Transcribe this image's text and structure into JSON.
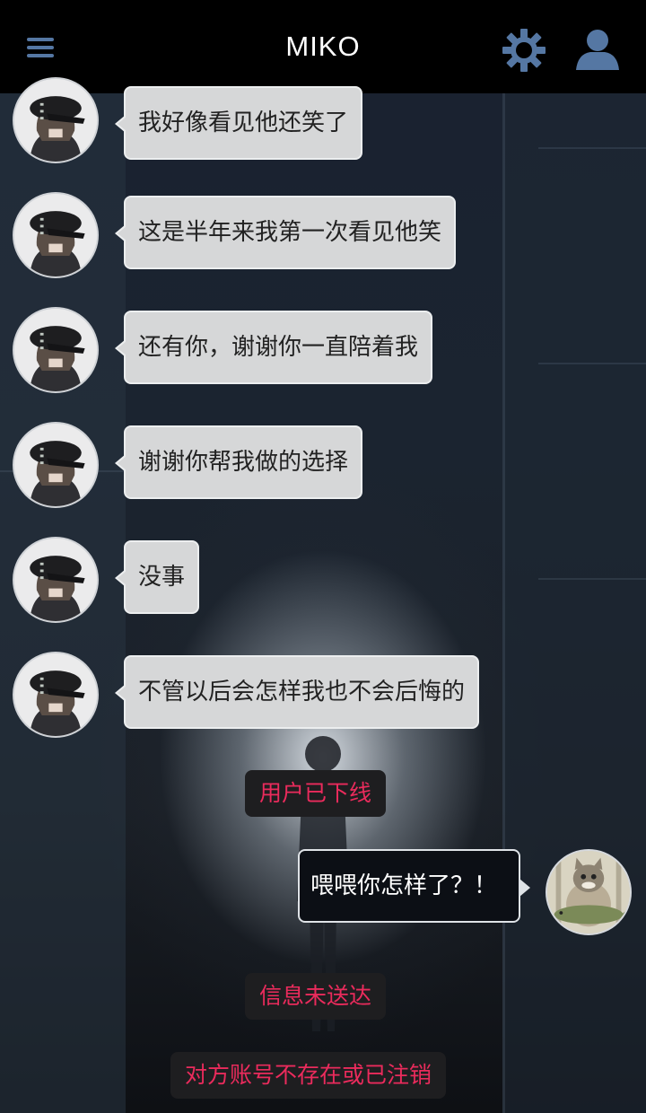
{
  "header": {
    "title": "MIKO",
    "menu_icon": "hamburger-menu-icon",
    "settings_icon": "gear-icon",
    "profile_icon": "user-icon"
  },
  "colors": {
    "header_bg": "#000000",
    "icon_blue": "#5577a3",
    "bubble_in": "#d6d7d8",
    "bubble_out": "#0c0f15",
    "system_text": "#ea2b5c"
  },
  "messages": [
    {
      "from": "miko",
      "text": "我好像看见他还笑了"
    },
    {
      "from": "miko",
      "text": "这是半年来我第一次看见他笑"
    },
    {
      "from": "miko",
      "text": "还有你，谢谢你一直陪着我"
    },
    {
      "from": "miko",
      "text": "谢谢你帮我做的选择"
    },
    {
      "from": "miko",
      "text": "没事"
    },
    {
      "from": "miko",
      "text": "不管以后会怎样我也不会后悔的"
    }
  ],
  "system_offline": "用户已下线",
  "outgoing": {
    "text": "喂喂你怎样了？！"
  },
  "system_not_delivered": "信息未送达",
  "system_account_gone": "对方账号不存在或已注销"
}
